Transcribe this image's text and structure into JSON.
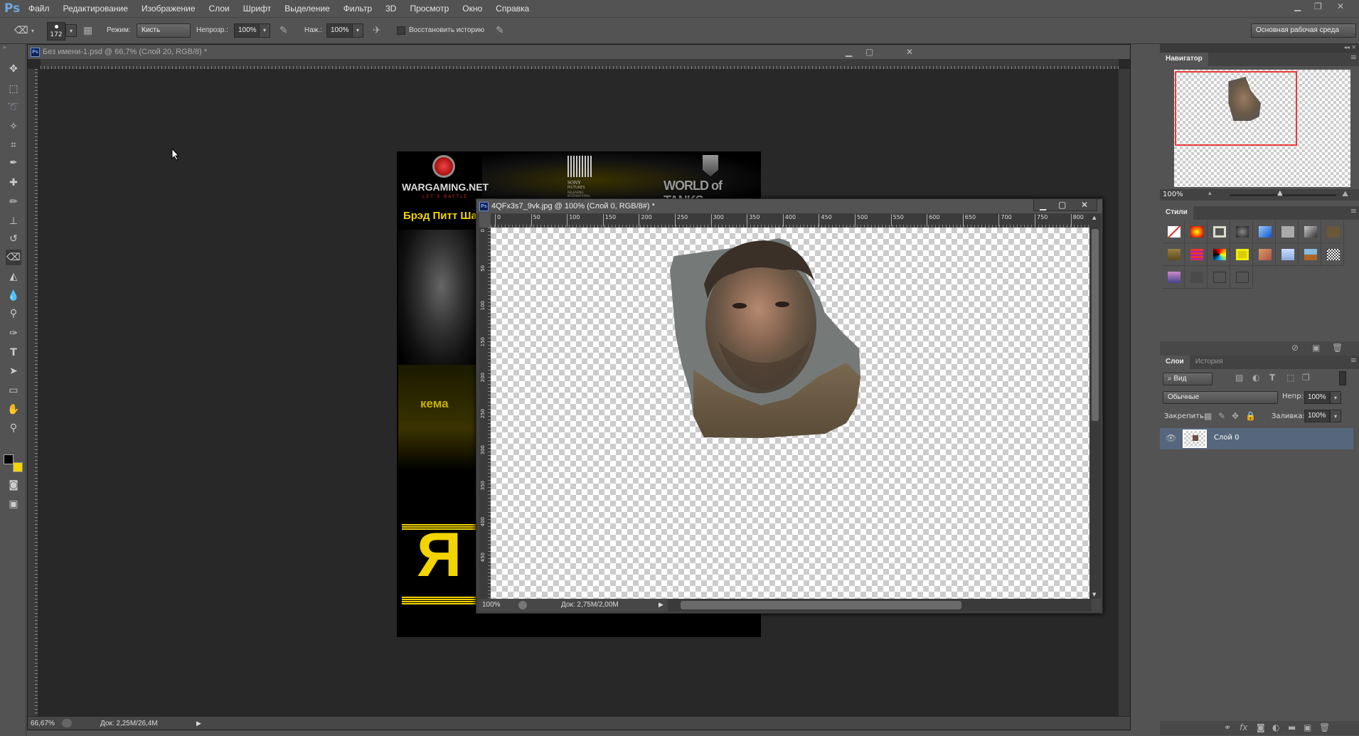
{
  "app": {
    "logo": "Ps",
    "menu": [
      "Файл",
      "Редактирование",
      "Изображение",
      "Слои",
      "Шрифт",
      "Выделение",
      "Фильтр",
      "3D",
      "Просмотр",
      "Окно",
      "Справка"
    ],
    "workspace": "Основная рабочая среда"
  },
  "options": {
    "brush_size": "172",
    "mode_label": "Режим:",
    "mode_value": "Кисть",
    "opacity_label": "Непрозр.:",
    "opacity_value": "100%",
    "flow_label": "Наж.:",
    "flow_value": "100%",
    "restore_history_label": "Восстановить историю",
    "restore_history_checked": false
  },
  "tools": [
    "move-tool",
    "marquee-tool",
    "lasso-tool",
    "magic-wand-tool",
    "crop-tool",
    "eyedropper-tool",
    "healing-brush-tool",
    "brush-tool",
    "clone-stamp-tool",
    "history-brush-tool",
    "eraser-tool",
    "paint-bucket-tool",
    "blur-tool",
    "dodge-tool",
    "pen-tool",
    "type-tool",
    "path-selection-tool",
    "rectangle-tool",
    "hand-tool",
    "zoom-tool"
  ],
  "colors": {
    "foreground": "#000000",
    "background": "#f2d400",
    "accent_selection": "#e8393a",
    "layer_selected": "#56677d"
  },
  "doc1": {
    "title": "Без имени-1.psd @ 66,7% (Слой 20, RGB/8) *",
    "zoom": "66,67%",
    "doc_size": "Док: 2,25M/26,4M",
    "poster": {
      "wargaming": "WARGAMING.NET",
      "wargaming_tagline": "LET'S BATTLE",
      "sony": "SONY",
      "sony_sub": "PICTURES",
      "sony_sub2": "RELEASING INTERNATIONAL",
      "wot": "WORLD of TANKS",
      "headline": "Брэд Питт Ша",
      "mid_text": "кема",
      "big_letter": "Я"
    }
  },
  "doc2": {
    "title": "4QFx3s7_9vk.jpg @ 100% (Слой 0, RGB/8#) *",
    "zoom": "100%",
    "doc_size": "Док: 2,75M/2,00M",
    "hruler": [
      "0",
      "50",
      "100",
      "150",
      "200",
      "250",
      "300",
      "350",
      "400",
      "450",
      "500",
      "550",
      "600",
      "650",
      "700",
      "750",
      "800"
    ],
    "vruler": [
      "0",
      "50",
      "100",
      "150",
      "200",
      "250",
      "300",
      "350",
      "400",
      "450"
    ]
  },
  "navigator": {
    "tab": "Навигатор",
    "zoom": "100%"
  },
  "styles": {
    "tab": "Стили"
  },
  "layers": {
    "tab": "Слои",
    "tab2": "История",
    "filter": "Вид",
    "blend_mode": "Обычные",
    "opacity_label": "Непр:",
    "opacity": "100%",
    "lock_label": "Закрепить:",
    "fill_label": "Заливка:",
    "fill": "100%",
    "items": [
      {
        "name": "Слой 0",
        "visible": true,
        "selected": true
      }
    ]
  }
}
